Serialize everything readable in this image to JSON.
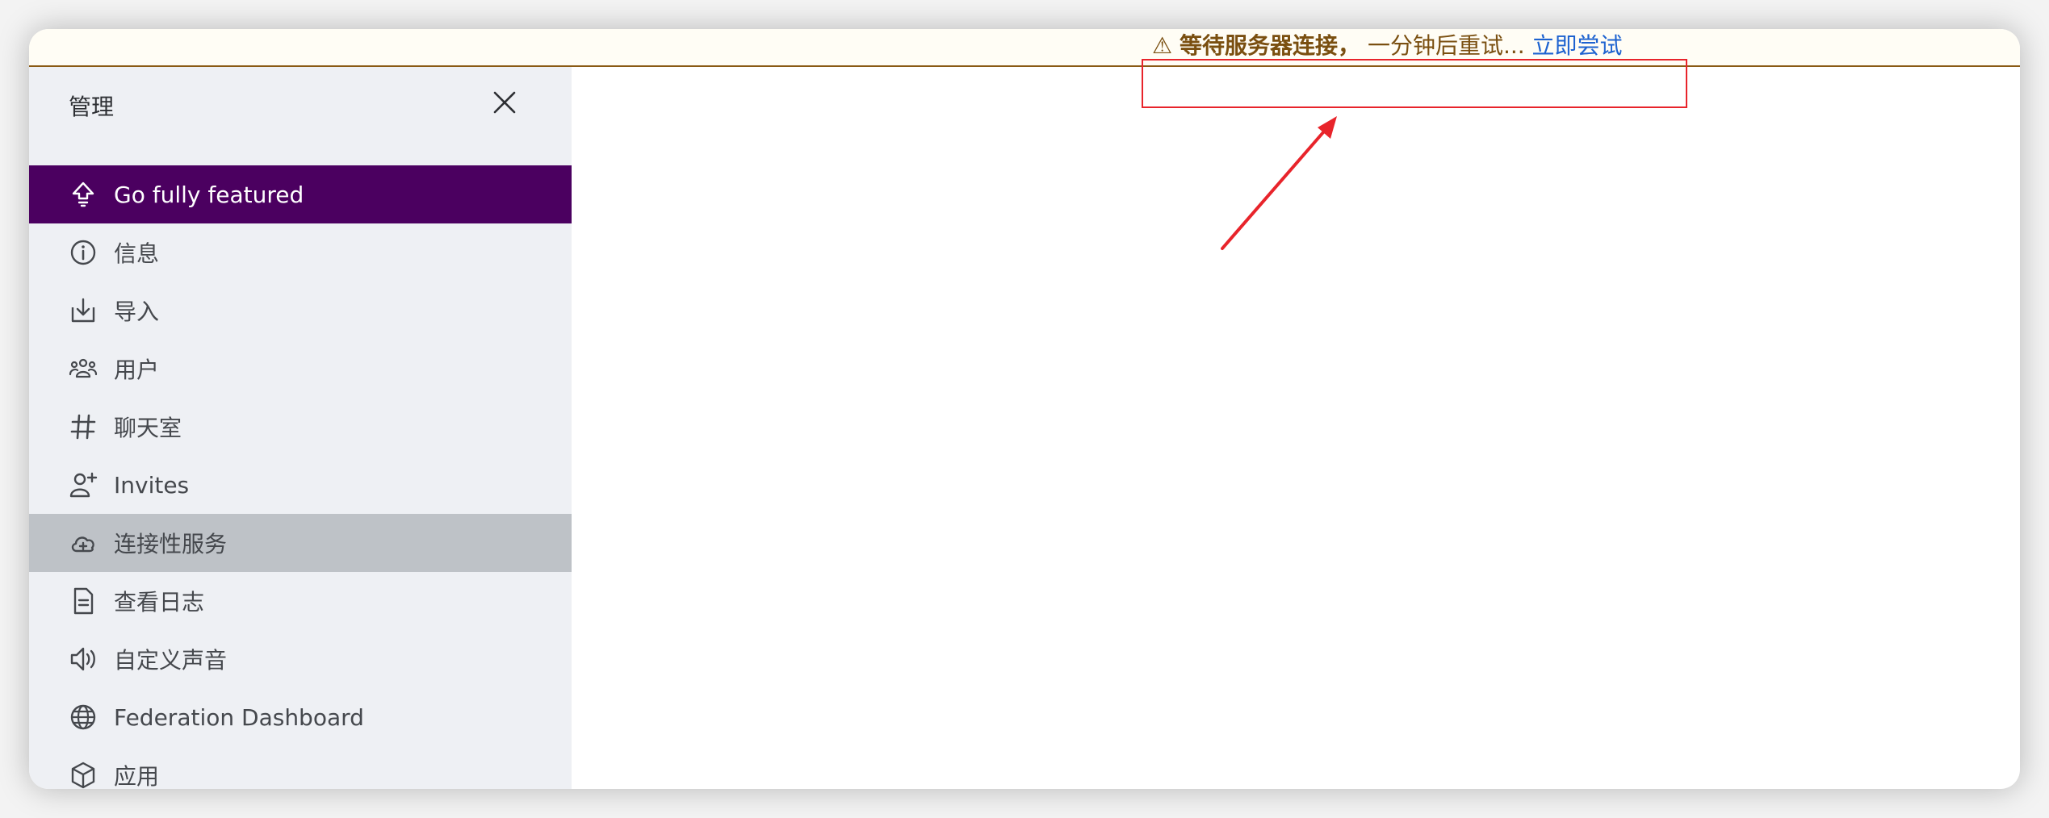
{
  "banner": {
    "warning_icon": "⚠",
    "strong_text": "等待服务器连接，",
    "text": "一分钟后重试...",
    "retry_link": "立即尝试"
  },
  "sidebar": {
    "title": "管理",
    "close_icon": "close-icon",
    "items": [
      {
        "label": "Go fully featured",
        "icon": "upgrade-arrow-icon",
        "state": "active"
      },
      {
        "label": "信息",
        "icon": "info-icon"
      },
      {
        "label": "导入",
        "icon": "import-icon"
      },
      {
        "label": "用户",
        "icon": "users-icon"
      },
      {
        "label": "聊天室",
        "icon": "hashtag-icon"
      },
      {
        "label": "Invites",
        "icon": "user-plus-icon"
      },
      {
        "label": "连接性服务",
        "icon": "cloud-plus-icon",
        "state": "selected"
      },
      {
        "label": "查看日志",
        "icon": "document-icon"
      },
      {
        "label": "自定义声音",
        "icon": "speaker-icon"
      },
      {
        "label": "Federation Dashboard",
        "icon": "globe-icon"
      },
      {
        "label": "应用",
        "icon": "cube-icon"
      }
    ]
  },
  "colors": {
    "accent": "#4b0060",
    "banner_text": "#7a4f10",
    "link": "#1d62d0",
    "annotation": "#e8242b"
  }
}
